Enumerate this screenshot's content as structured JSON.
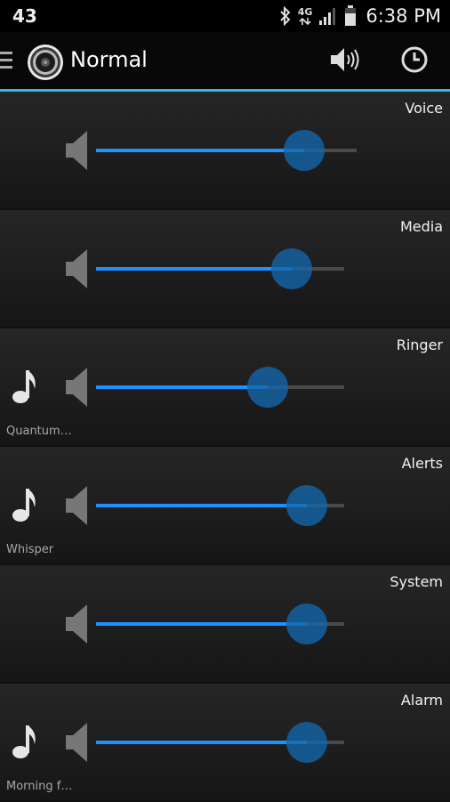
{
  "status_bar": {
    "left_text": "43",
    "network_label": "4G",
    "time": "6:38 PM",
    "icons": [
      "bluetooth-icon",
      "network-4g-icon",
      "signal-icon",
      "battery-icon"
    ]
  },
  "action_bar": {
    "title": "Normal",
    "app_icon": "speaker-logo-icon",
    "actions": [
      "volume-icon",
      "clock-icon"
    ]
  },
  "colors": {
    "accent": "#33b5e5",
    "slider_fill": "#1e90ff",
    "thumb": "#1367ac",
    "track": "#4a4a4a"
  },
  "rows": [
    {
      "label": "Voice",
      "tone": "",
      "level": 0.8
    },
    {
      "label": "Media",
      "tone": "",
      "level": 0.79
    },
    {
      "label": "Ringer",
      "tone": "Quantum…",
      "level": 0.69
    },
    {
      "label": "Alerts",
      "tone": "Whisper",
      "level": 0.85
    },
    {
      "label": "System",
      "tone": "",
      "level": 0.85
    },
    {
      "label": "Alarm",
      "tone": "Morning f…",
      "level": 0.85
    }
  ]
}
